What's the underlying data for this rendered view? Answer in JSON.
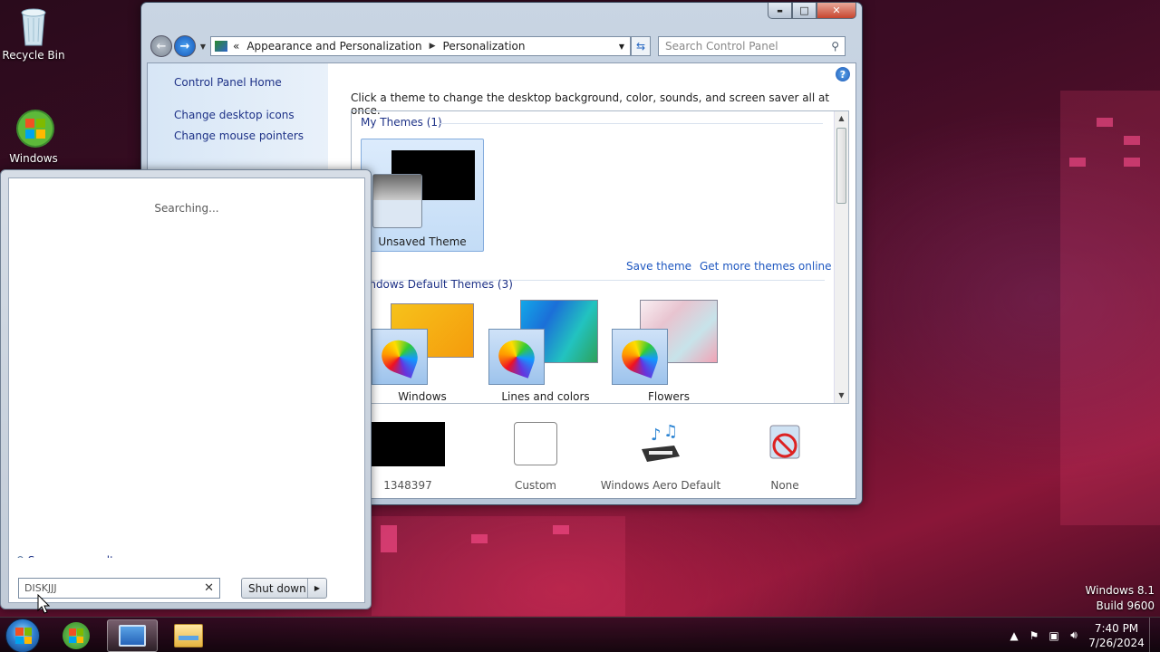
{
  "desktop": {
    "icons": [
      {
        "label": "Recycle Bin",
        "icon": "recycle-bin-icon"
      },
      {
        "label": "Windows",
        "icon": "windows-logo-icon"
      }
    ],
    "watermark": {
      "line1": "Windows 8.1",
      "line2": "Build 9600"
    }
  },
  "window": {
    "caption_buttons": {
      "minimize": "▬",
      "maximize": "□",
      "close": "✕"
    },
    "address": {
      "prefix": "«",
      "crumb1": "Appearance and Personalization",
      "crumb2": "Personalization"
    },
    "search_placeholder": "Search Control Panel",
    "sidebar": {
      "home": "Control Panel Home",
      "links": [
        "Change desktop icons",
        "Change mouse pointers"
      ]
    },
    "intro": "Click a theme to change the desktop background, color, sounds, and screen saver all at once.",
    "my_themes": {
      "header": "My Themes (1)",
      "items": [
        {
          "label": "Unsaved Theme",
          "selected": true
        }
      ]
    },
    "actions": {
      "save": "Save theme",
      "more": "Get more themes online"
    },
    "default_themes": {
      "header": "indows Default Themes (3)",
      "items": [
        "Windows",
        "Lines and colors",
        "Flowers"
      ]
    },
    "bottom": [
      {
        "label": "1348397",
        "icon": "desktop-background-icon"
      },
      {
        "label": "Custom",
        "icon": "color-swatch-icon"
      },
      {
        "label": "Windows Aero Default",
        "icon": "sounds-icon"
      },
      {
        "label": "None",
        "icon": "screen-saver-none-icon"
      }
    ]
  },
  "start_menu": {
    "status": "Searching...",
    "see_more": "See more results",
    "search_value": "DISKJJJ",
    "shutdown": "Shut down"
  },
  "taskbar": {
    "clock_time": "7:40 PM",
    "clock_date": "7/26/2024"
  }
}
